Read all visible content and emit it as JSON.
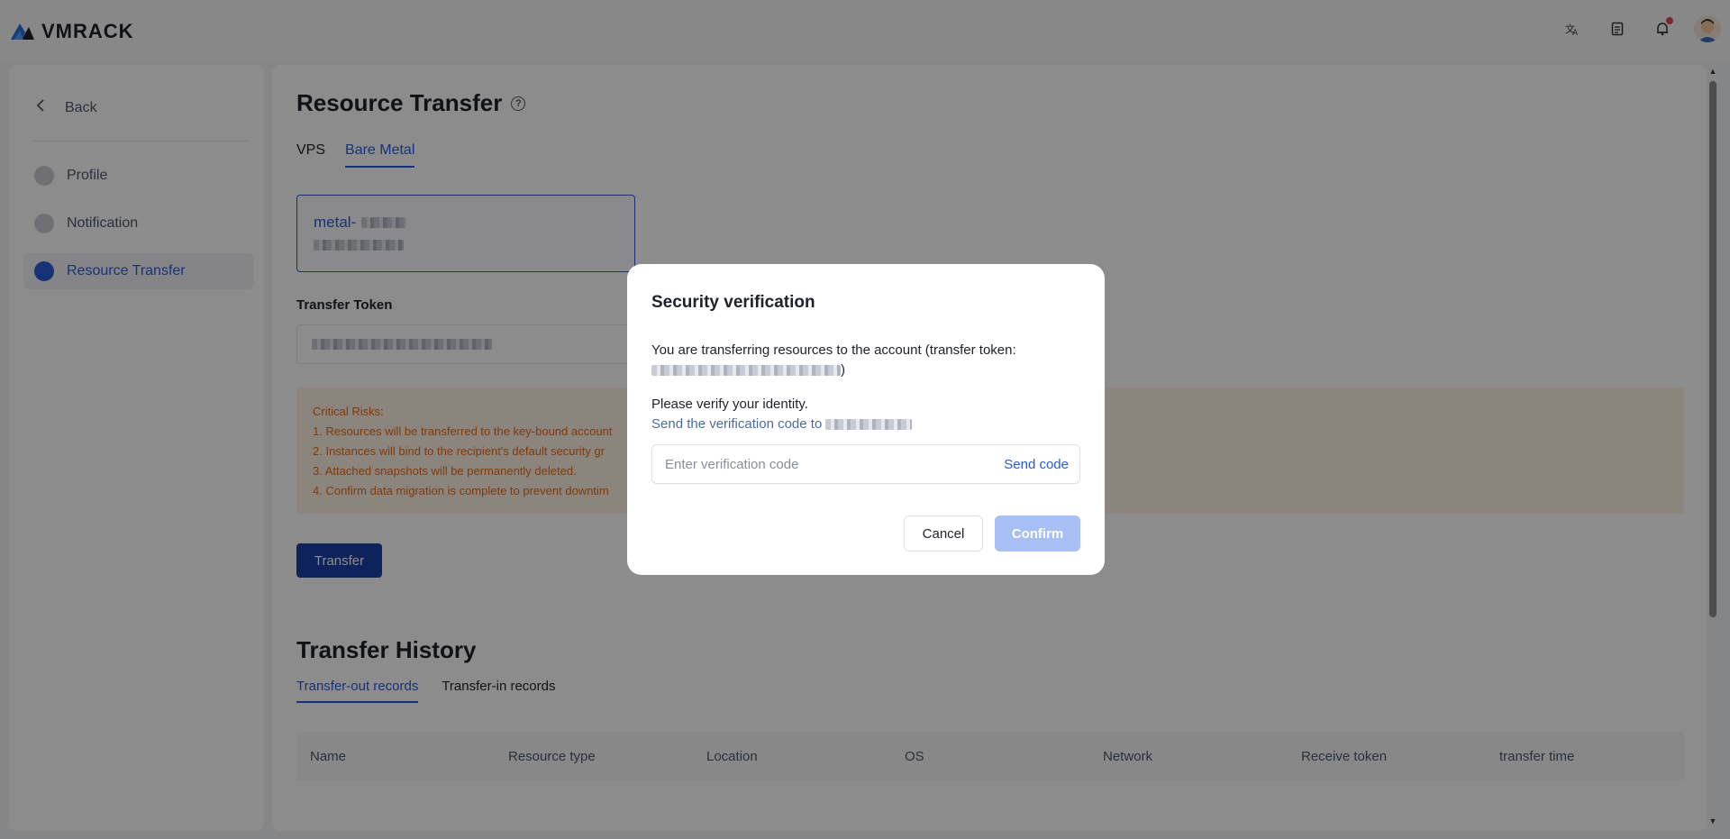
{
  "header": {
    "logo_text": "VMRACK",
    "icons": [
      "translate-icon",
      "document-icon",
      "bell-icon",
      "avatar"
    ]
  },
  "sidebar": {
    "back_label": "Back",
    "items": [
      {
        "label": "Profile",
        "icon": "profile-icon"
      },
      {
        "label": "Notification",
        "icon": "notification-icon"
      },
      {
        "label": "Resource Transfer",
        "icon": "transfer-icon",
        "active": true
      }
    ]
  },
  "main": {
    "title": "Resource Transfer",
    "tabs": [
      {
        "label": "VPS"
      },
      {
        "label": "Bare Metal",
        "active": true
      }
    ],
    "resource_card": {
      "name_prefix": "metal-"
    },
    "token_label": "Transfer Token",
    "risks": {
      "heading": "Critical Risks:",
      "items": [
        "1. Resources will be transferred to the key-bound account",
        "2. Instances will bind to the recipient's default security gr",
        "3. Attached snapshots will be permanently deleted.",
        "4. Confirm data migration is complete to prevent downtim"
      ]
    },
    "transfer_button": "Transfer"
  },
  "history": {
    "title": "Transfer History",
    "tabs": [
      {
        "label": "Transfer-out records",
        "active": true
      },
      {
        "label": "Transfer-in records"
      }
    ],
    "columns": [
      "Name",
      "Resource type",
      "Location",
      "OS",
      "Network",
      "Receive token",
      "transfer time"
    ]
  },
  "modal": {
    "title": "Security verification",
    "message": "You are transferring resources to the account (transfer token:",
    "message_close": ")",
    "verify_prompt": "Please verify your identity.",
    "send_to_label": "Send the verification code to",
    "code_placeholder": "Enter verification code",
    "send_code_label": "Send code",
    "cancel_label": "Cancel",
    "confirm_label": "Confirm"
  },
  "colors": {
    "accent": "#2a5bd7",
    "primary_button": "#1a3fa8",
    "confirm_disabled": "#a6c0f5",
    "risk_text": "#e86a17",
    "risk_bg": "#fdf3e6"
  }
}
